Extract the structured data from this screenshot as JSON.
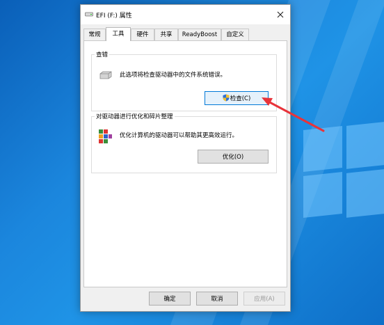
{
  "window": {
    "title": "EFI (F:) 属性"
  },
  "tabs": [
    {
      "label": "常规"
    },
    {
      "label": "工具"
    },
    {
      "label": "硬件"
    },
    {
      "label": "共享"
    },
    {
      "label": "ReadyBoost"
    },
    {
      "label": "自定义"
    }
  ],
  "check_group": {
    "title": "查错",
    "description": "此选项将检查驱动器中的文件系统错误。",
    "button_label": "检查(C)"
  },
  "optimize_group": {
    "title": "对驱动器进行优化和碎片整理",
    "description": "优化计算机的驱动器可以帮助其更高效运行。",
    "button_label": "优化(O)"
  },
  "footer": {
    "ok_label": "确定",
    "cancel_label": "取消",
    "apply_label": "应用(A)"
  },
  "colors": {
    "desktop_blue": "#1b86dd",
    "annotation_red": "#e8333a",
    "focus_border": "#0078d7"
  }
}
